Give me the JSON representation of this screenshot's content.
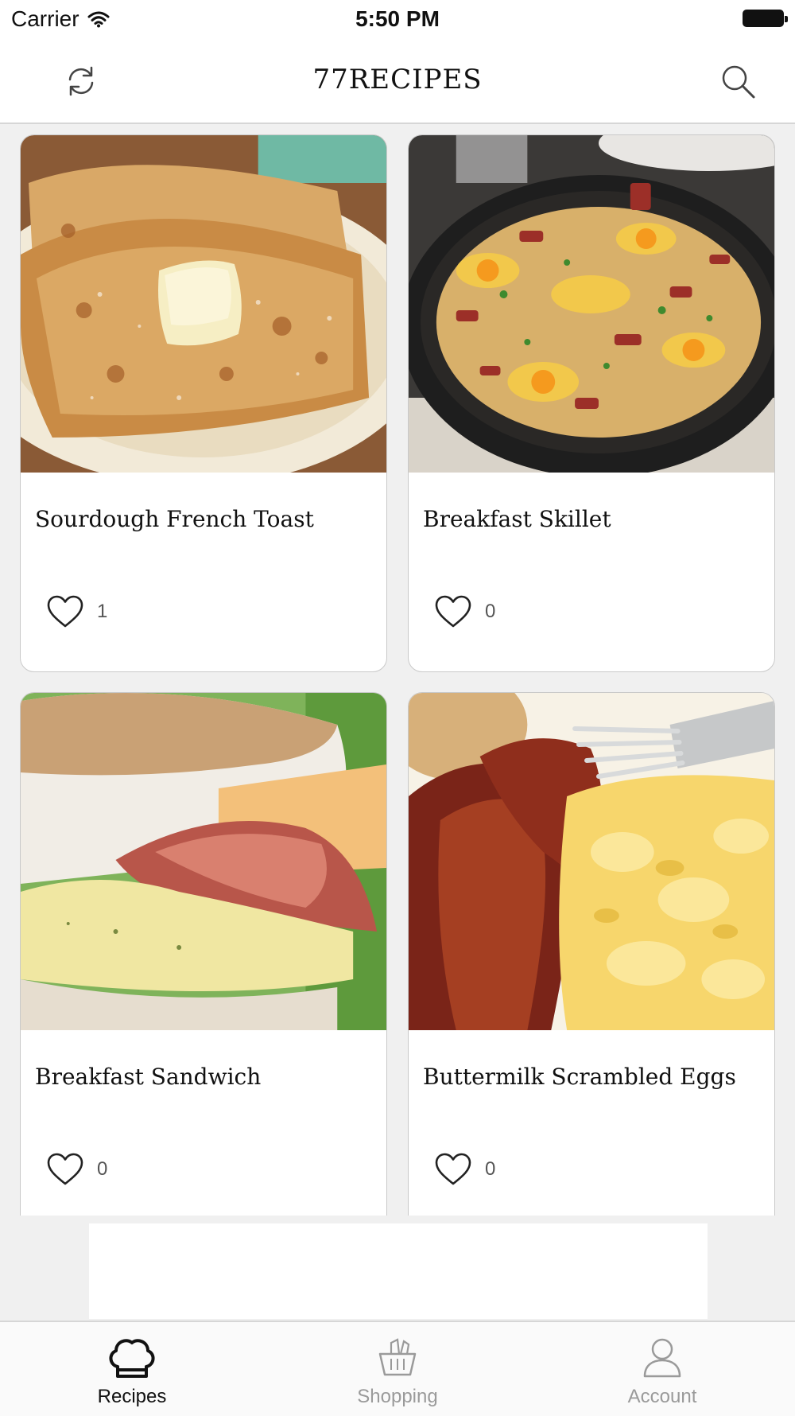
{
  "status_bar": {
    "carrier": "Carrier",
    "time": "5:50 PM"
  },
  "nav": {
    "title": "77RECIPES",
    "left_icon": "refresh-icon",
    "right_icon": "search-icon"
  },
  "recipes": [
    {
      "title": "Sourdough French Toast",
      "likes": "1"
    },
    {
      "title": "Breakfast Skillet",
      "likes": "0"
    },
    {
      "title": "Breakfast Sandwich",
      "likes": "0"
    },
    {
      "title": "Buttermilk Scrambled Eggs",
      "likes": "0"
    }
  ],
  "tabs": [
    {
      "label": "Recipes",
      "icon": "chef-hat-icon",
      "active": true
    },
    {
      "label": "Shopping",
      "icon": "basket-icon",
      "active": false
    },
    {
      "label": "Account",
      "icon": "user-icon",
      "active": false
    }
  ],
  "colors": {
    "active_tab": "#111111",
    "inactive_tab": "#9a9a9a",
    "card_border": "#c9c9c9"
  }
}
